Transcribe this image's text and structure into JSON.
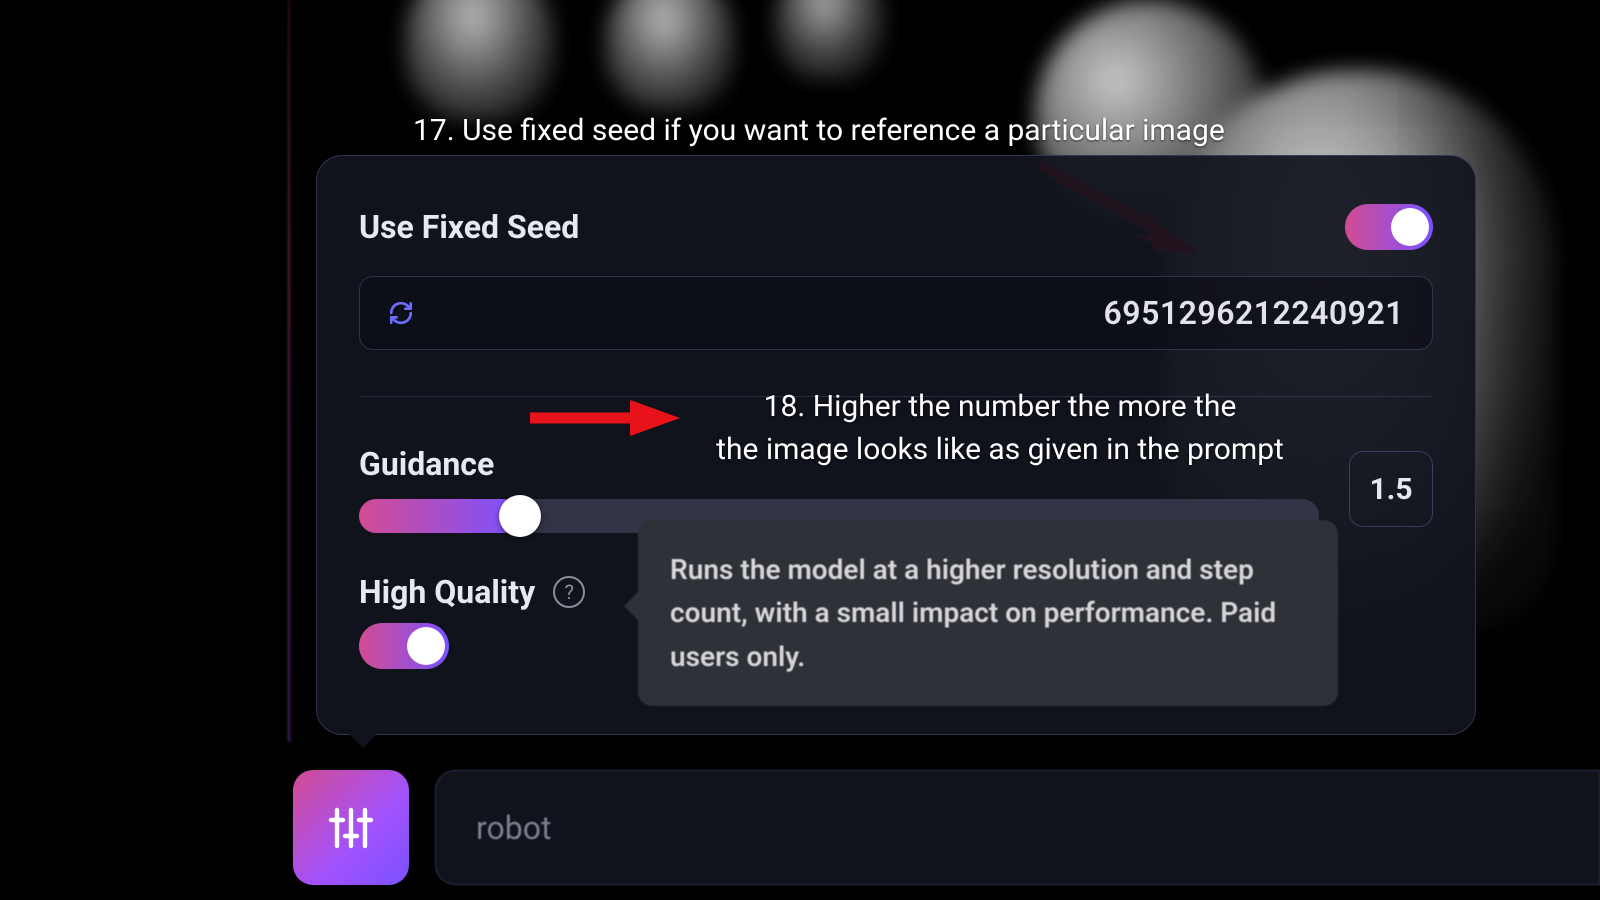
{
  "annotations": {
    "seed_tip": "17. Use fixed seed if you want to reference a particular image",
    "guidance_tip_line1": "18. Higher the number the more the",
    "guidance_tip_line2": "the image looks like as given in the prompt"
  },
  "panel": {
    "fixed_seed_label": "Use Fixed Seed",
    "seed_value": "6951296212240921",
    "guidance_label": "Guidance",
    "guidance_value": "1.5",
    "high_quality_label": "High Quality",
    "help_glyph": "?"
  },
  "tooltip": {
    "text": "Runs the model at a higher resolution and step count, with a small impact on performance. Paid users only."
  },
  "bottom": {
    "prompt_value": "robot"
  }
}
